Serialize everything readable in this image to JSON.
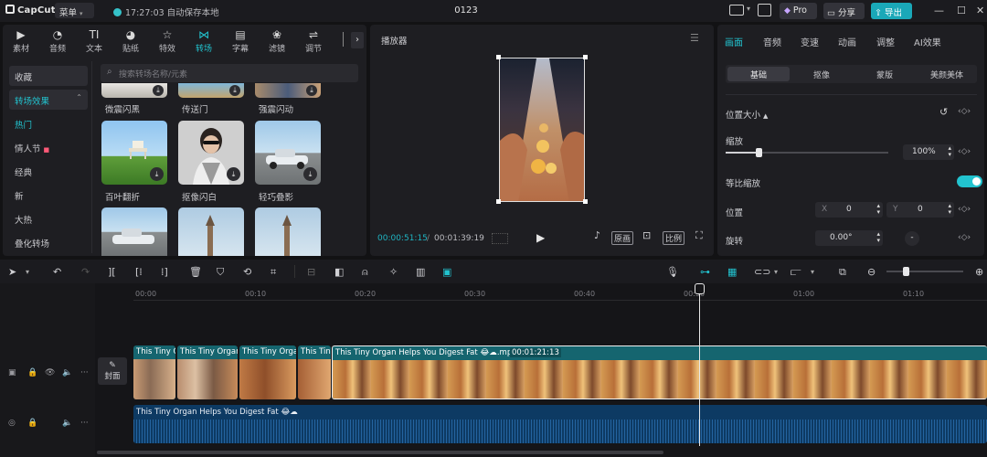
{
  "app": {
    "logo": "CapCut",
    "menu_label": "菜单",
    "autosave": "17:27:03 自动保存本地",
    "project_title": "0123",
    "pro_label": "Pro",
    "share_label": "分享",
    "export_label": "导出"
  },
  "tools": [
    {
      "label": "素材",
      "icon": "media-icon"
    },
    {
      "label": "音频",
      "icon": "audio-icon"
    },
    {
      "label": "文本",
      "icon": "text-icon"
    },
    {
      "label": "贴纸",
      "icon": "sticker-icon"
    },
    {
      "label": "特效",
      "icon": "effects-icon"
    },
    {
      "label": "转场",
      "icon": "transition-icon"
    },
    {
      "label": "字幕",
      "icon": "captions-icon"
    },
    {
      "label": "滤镜",
      "icon": "filter-icon"
    },
    {
      "label": "调节",
      "icon": "adjust-icon"
    }
  ],
  "sidebar": {
    "items": [
      {
        "label": "收藏"
      },
      {
        "label": "转场效果"
      },
      {
        "label": "热门"
      },
      {
        "label": "情人节"
      },
      {
        "label": "经典"
      },
      {
        "label": "新"
      },
      {
        "label": "大热"
      },
      {
        "label": "叠化转场"
      }
    ]
  },
  "search": {
    "placeholder": "搜索转场名称/元素"
  },
  "transitions": {
    "row0": [
      "微震闪黑",
      "传送门",
      "强震闪动"
    ],
    "row1": [
      "百叶翻折",
      "抠像闪白",
      "轻巧叠影"
    ]
  },
  "player": {
    "title": "播放器",
    "current_time": "00:00:51:15",
    "total_time": "00:01:39:19",
    "original_label": "原画",
    "ratio_label": "比例"
  },
  "properties": {
    "tabs": [
      "画面",
      "音频",
      "变速",
      "动画",
      "调整",
      "AI效果"
    ],
    "subtabs": [
      "基础",
      "抠像",
      "蒙版",
      "美颜美体"
    ],
    "position_size": "位置大小",
    "scale_label": "缩放",
    "scale_value": "100%",
    "scale_level": 1.0,
    "uniform_scale": "等比缩放",
    "position_label": "位置",
    "x_label": "X",
    "x_value": "0",
    "y_label": "Y",
    "y_value": "0",
    "rotate_label": "旋转",
    "rotate_value": "0.00°",
    "colors": {
      "accent": "#22c3cf"
    }
  },
  "timeline": {
    "ticks": [
      "00:00",
      "00:10",
      "00:20",
      "00:30",
      "00:40",
      "00:50",
      "01:00",
      "01:10"
    ],
    "cover_label": "封面",
    "clips": [
      {
        "label": "This Tiny O"
      },
      {
        "label": "This Tiny Organ"
      },
      {
        "label": "This Tiny Organ"
      },
      {
        "label": "This Tiny"
      },
      {
        "label": "This Tiny Organ Helps You Digest Fat 😂☁.mp4",
        "duration": "00:01:21:13"
      }
    ],
    "audio_label": "This Tiny Organ Helps You Digest Fat 😂☁"
  }
}
